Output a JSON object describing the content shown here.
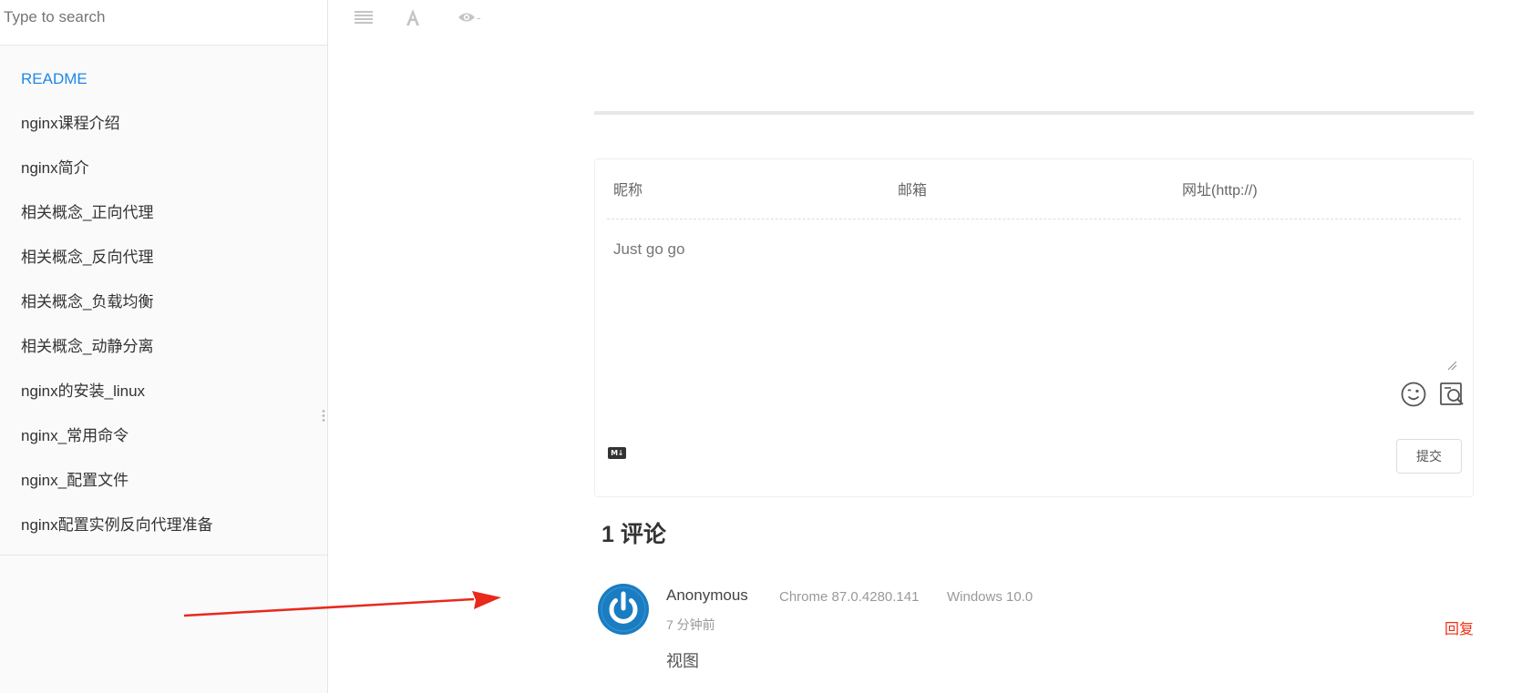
{
  "search": {
    "placeholder": "Type to search"
  },
  "toc": [
    {
      "label": "README",
      "active": true
    },
    {
      "label": "nginx课程介绍"
    },
    {
      "label": "nginx简介"
    },
    {
      "label": "相关概念_正向代理"
    },
    {
      "label": "相关概念_反向代理"
    },
    {
      "label": "相关概念_负载均衡"
    },
    {
      "label": "相关概念_动静分离"
    },
    {
      "label": "nginx的安装_linux"
    },
    {
      "label": "nginx_常用命令"
    },
    {
      "label": "nginx_配置文件"
    },
    {
      "label": "nginx配置实例反向代理准备"
    }
  ],
  "toolbar": {
    "icons": [
      "menu-icon",
      "font-settings-icon",
      "eye-icon"
    ],
    "eye_suffix": "-"
  },
  "comment_form": {
    "nick_placeholder": "昵称",
    "mail_placeholder": "邮箱",
    "link_placeholder": "网址(http://)",
    "content_placeholder": "Just go go",
    "md_badge": "M↓",
    "submit_label": "提交"
  },
  "comments": {
    "count_title": "1 评论",
    "items": [
      {
        "author": "Anonymous",
        "browser": "Chrome 87.0.4280.141",
        "os": "Windows 10.0",
        "time": "7 分钟前",
        "reply_label": "回复",
        "body": "视图"
      }
    ]
  },
  "colors": {
    "accent": "#1e88e5",
    "reply": "#ef2f11",
    "avatar": "#1a7dc1",
    "annotation_arrow": "#e8291c"
  }
}
